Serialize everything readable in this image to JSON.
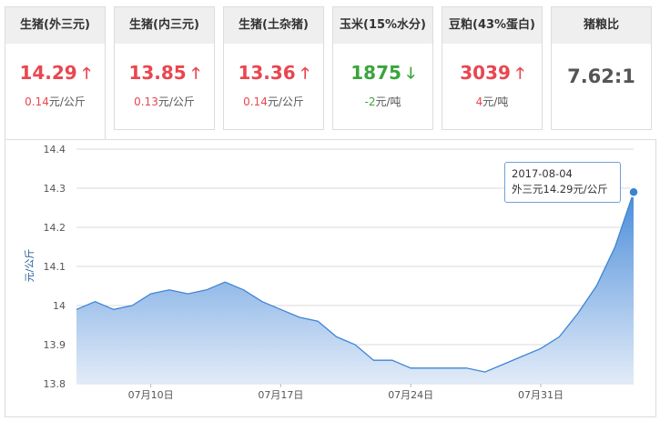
{
  "cards": [
    {
      "title": "生猪(外三元)",
      "price": "14.29",
      "direction": "up",
      "change_value": "0.14",
      "change_unit": "元/公斤"
    },
    {
      "title": "生猪(内三元)",
      "price": "13.85",
      "direction": "up",
      "change_value": "0.13",
      "change_unit": "元/公斤"
    },
    {
      "title": "生猪(土杂猪)",
      "price": "13.36",
      "direction": "up",
      "change_value": "0.14",
      "change_unit": "元/公斤"
    },
    {
      "title": "玉米(15%水分)",
      "price": "1875",
      "direction": "down",
      "change_value": "-2",
      "change_unit": "元/吨"
    },
    {
      "title": "豆粕(43%蛋白)",
      "price": "3039",
      "direction": "up",
      "change_value": "4",
      "change_unit": "元/吨"
    },
    {
      "title": "猪粮比",
      "ratio": "7.62:1"
    }
  ],
  "icons": {
    "up": "arrow-up-icon",
    "down": "arrow-down-icon"
  },
  "colors": {
    "up": "#e9464f",
    "down": "#3aa43c",
    "line": "#3f85d6",
    "area_top": "#3f86d8",
    "area_bottom": "#dfe9f7",
    "tooltip_border": "#6fa1d8"
  },
  "tooltip": {
    "date": "2017-08-04",
    "series": "外三元",
    "value": "14.29",
    "unit": "元/公斤"
  },
  "chart_data": {
    "type": "area",
    "ylabel": "元/公斤",
    "ylim": [
      13.8,
      14.4
    ],
    "yticks": [
      "13.8",
      "13.9",
      "14",
      "14.1",
      "14.2",
      "14.3",
      "14.4"
    ],
    "xticks": [
      {
        "label": "07月10日",
        "date": "2017-07-10"
      },
      {
        "label": "07月17日",
        "date": "2017-07-17"
      },
      {
        "label": "07月24日",
        "date": "2017-07-24"
      },
      {
        "label": "07月31日",
        "date": "2017-07-31"
      }
    ],
    "grid": true,
    "series": [
      {
        "points": [
          {
            "date": "2017-07-06",
            "value": 13.99
          },
          {
            "date": "2017-07-07",
            "value": 14.01
          },
          {
            "date": "2017-07-08",
            "value": 13.99
          },
          {
            "date": "2017-07-09",
            "value": 14.0
          },
          {
            "date": "2017-07-10",
            "value": 14.03
          },
          {
            "date": "2017-07-11",
            "value": 14.04
          },
          {
            "date": "2017-07-12",
            "value": 14.03
          },
          {
            "date": "2017-07-13",
            "value": 14.04
          },
          {
            "date": "2017-07-14",
            "value": 14.06
          },
          {
            "date": "2017-07-15",
            "value": 14.04
          },
          {
            "date": "2017-07-16",
            "value": 14.01
          },
          {
            "date": "2017-07-17",
            "value": 13.99
          },
          {
            "date": "2017-07-18",
            "value": 13.97
          },
          {
            "date": "2017-07-19",
            "value": 13.96
          },
          {
            "date": "2017-07-20",
            "value": 13.92
          },
          {
            "date": "2017-07-21",
            "value": 13.9
          },
          {
            "date": "2017-07-22",
            "value": 13.86
          },
          {
            "date": "2017-07-23",
            "value": 13.86
          },
          {
            "date": "2017-07-24",
            "value": 13.84
          },
          {
            "date": "2017-07-25",
            "value": 13.84
          },
          {
            "date": "2017-07-26",
            "value": 13.84
          },
          {
            "date": "2017-07-27",
            "value": 13.84
          },
          {
            "date": "2017-07-28",
            "value": 13.83
          },
          {
            "date": "2017-07-29",
            "value": 13.85
          },
          {
            "date": "2017-07-30",
            "value": 13.87
          },
          {
            "date": "2017-07-31",
            "value": 13.89
          },
          {
            "date": "2017-08-01",
            "value": 13.92
          },
          {
            "date": "2017-08-02",
            "value": 13.98
          },
          {
            "date": "2017-08-03",
            "value": 14.05
          },
          {
            "date": "2017-08-03",
            "value": 14.15
          },
          {
            "date": "2017-08-04",
            "value": 14.29
          }
        ]
      }
    ]
  }
}
